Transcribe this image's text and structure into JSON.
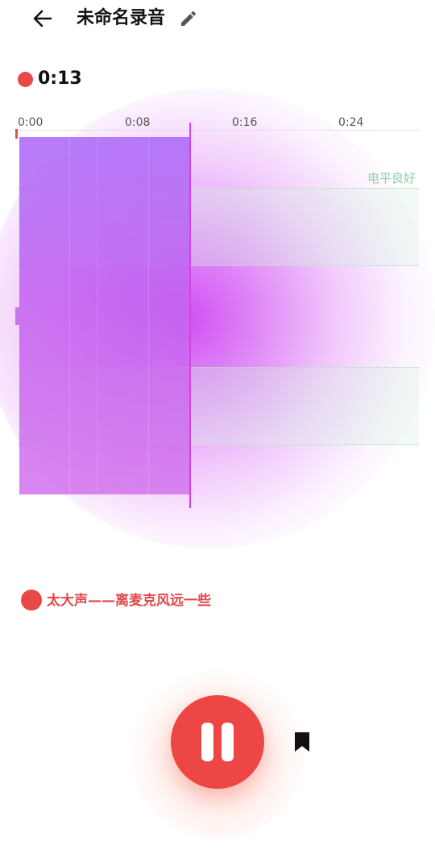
{
  "header": {
    "title": "未命名录音",
    "back_icon": "arrow-left-icon",
    "edit_icon": "pencil-icon"
  },
  "recording": {
    "elapsed": "0:13",
    "status_color": "#e84848"
  },
  "timeline": {
    "ticks": [
      "0:00",
      "0:08",
      "0:16",
      "0:24"
    ]
  },
  "level": {
    "label": "电平良好",
    "label_color": "#8fcfa8"
  },
  "warning": {
    "text": "太大声——离麦克风远一些",
    "color": "#e04848"
  },
  "controls": {
    "pause_icon": "pause-icon",
    "bookmark_icon": "bookmark-icon",
    "accent": "#ee4545"
  },
  "colors": {
    "waveform": "#c064f0",
    "glow": "#ce46f3"
  }
}
